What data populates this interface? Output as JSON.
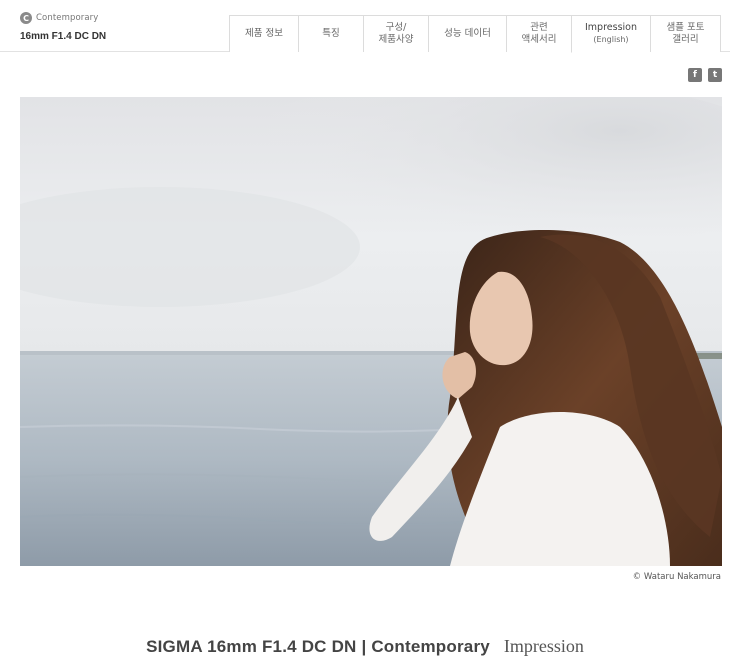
{
  "header": {
    "brand_badge": "C",
    "brand_name": "Contemporary",
    "product": "16mm F1.4 DC DN"
  },
  "nav": [
    {
      "line1": "제품 정보",
      "line2": ""
    },
    {
      "line1": "특징",
      "line2": ""
    },
    {
      "line1": "구성/",
      "line2": "제품사양"
    },
    {
      "line1": "성능 데이터",
      "line2": ""
    },
    {
      "line1": "관련",
      "line2": "액세서리"
    },
    {
      "line1": "Impression",
      "line2": "(English)"
    },
    {
      "line1": "샘플 포토",
      "line2": "갤러리"
    }
  ],
  "social": {
    "facebook": "f",
    "twitter": "t"
  },
  "photo": {
    "credit": "© Wataru Nakamura"
  },
  "bottom": {
    "title": "SIGMA 16mm F1.4 DC DN | Contemporary",
    "subtitle": "Impression"
  }
}
